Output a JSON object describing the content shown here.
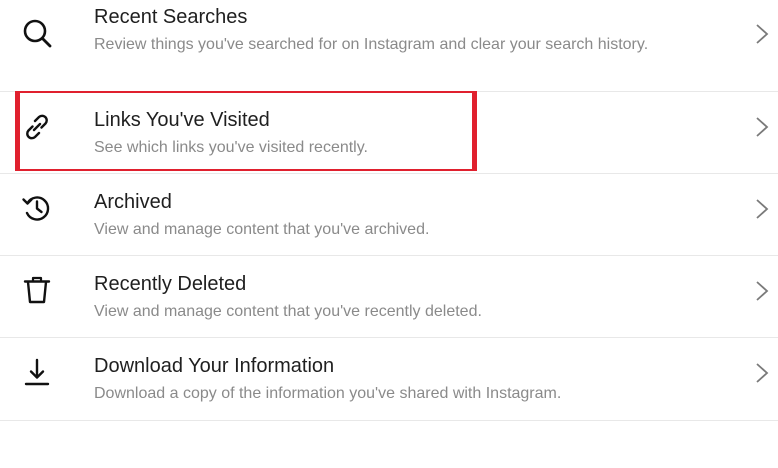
{
  "menu": {
    "items": [
      {
        "title": "Recent Searches",
        "description": "Review things you've searched for on Instagram and clear your search history.",
        "icon": "search-icon"
      },
      {
        "title": "Links You've Visited",
        "description": "See which links you've visited recently.",
        "icon": "link-icon",
        "highlighted": true
      },
      {
        "title": "Archived",
        "description": "View and manage content that you've archived.",
        "icon": "archive-history-icon"
      },
      {
        "title": "Recently Deleted",
        "description": "View and manage content that you've recently deleted.",
        "icon": "trash-icon"
      },
      {
        "title": "Download Your Information",
        "description": "Download a copy of the information you've shared with Instagram.",
        "icon": "download-icon"
      }
    ]
  },
  "colors": {
    "highlight": "#e0202e",
    "title": "#1f1f1f",
    "description": "#8a8a8a",
    "divider": "#e8e8e8"
  }
}
